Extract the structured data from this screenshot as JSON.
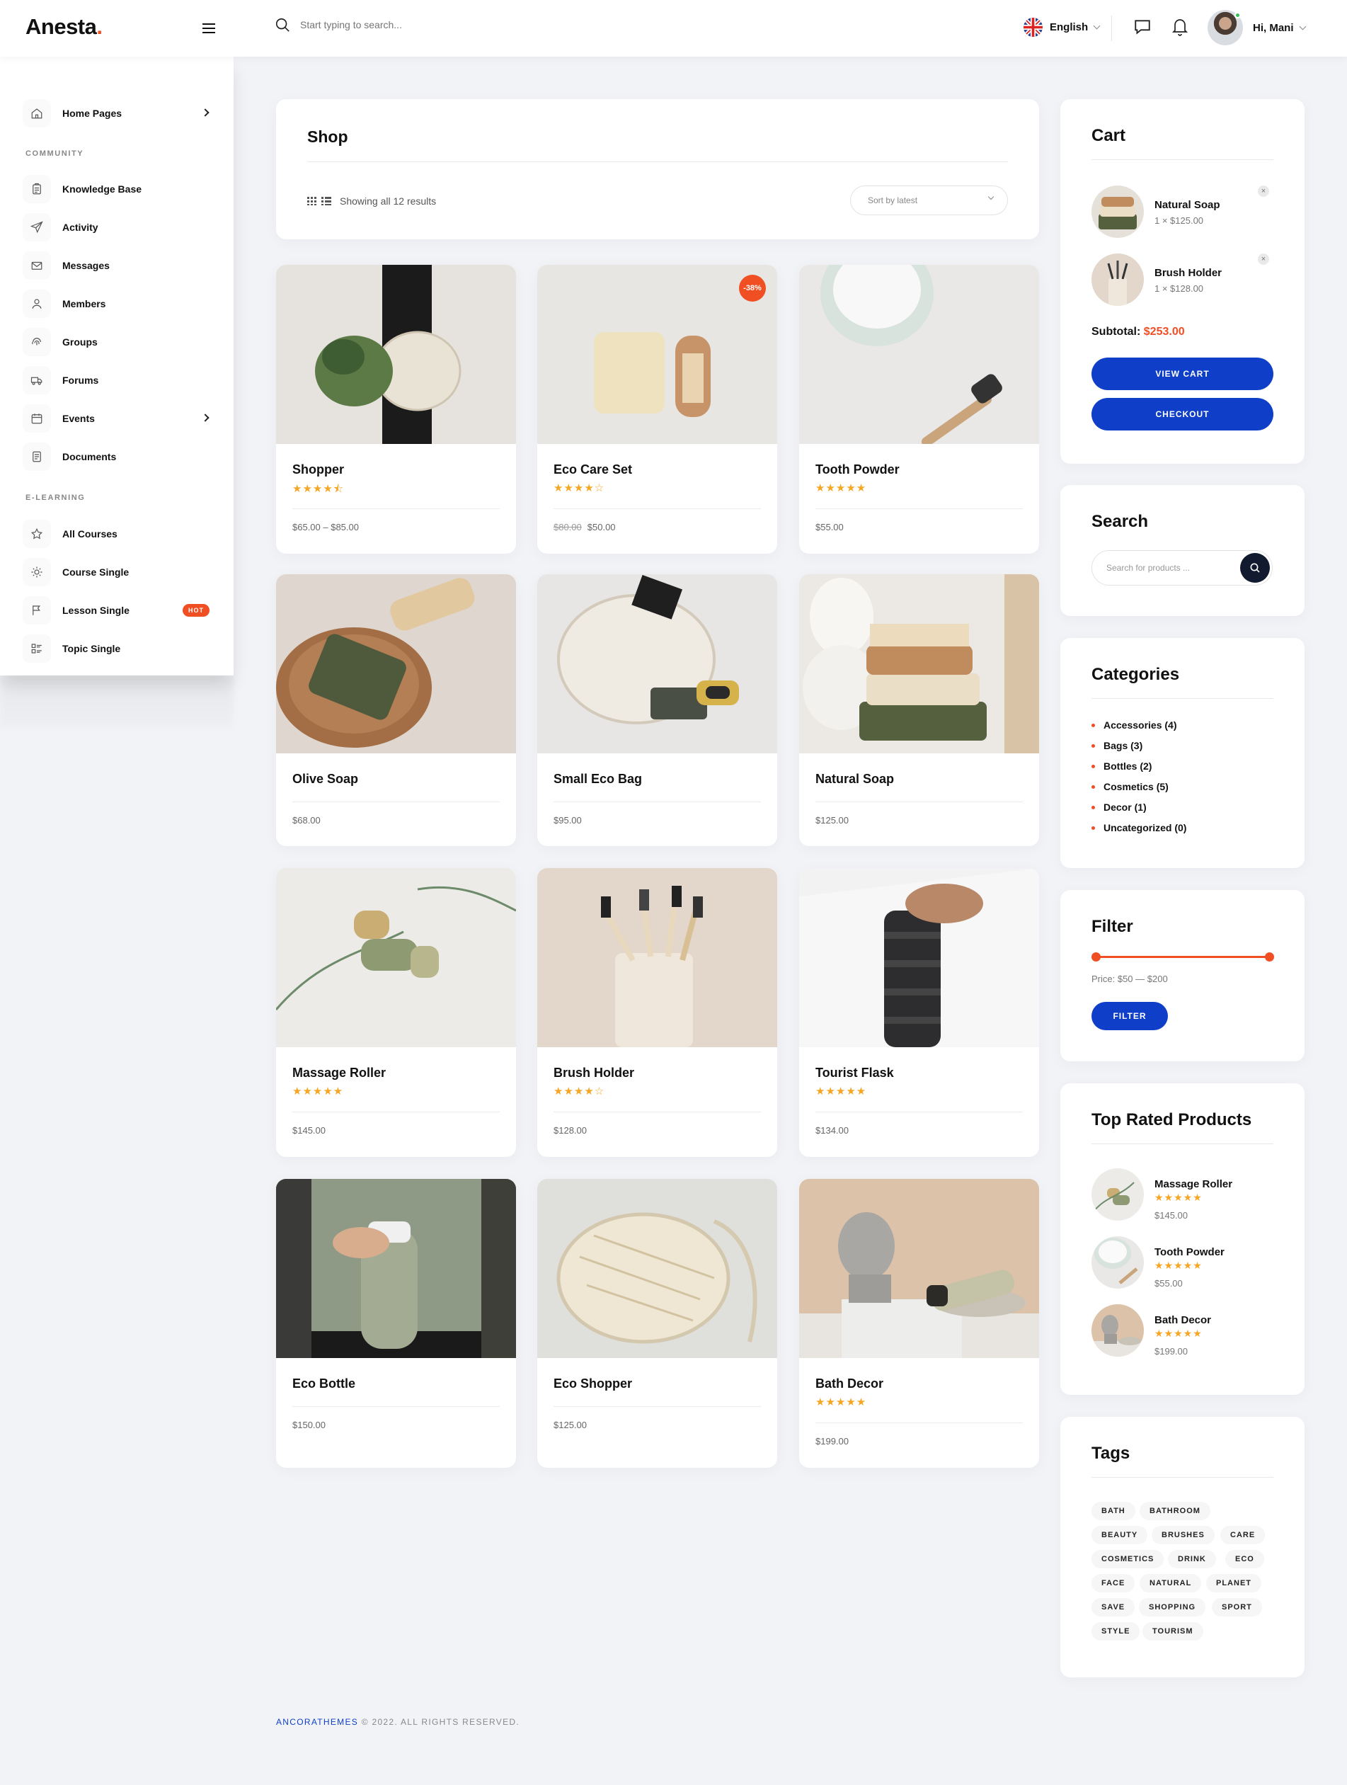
{
  "header": {
    "logo_text": "Anesta",
    "logo_dot": ".",
    "search_placeholder": "Start typing to search...",
    "language": "English",
    "greeting": "Hi,  Mani"
  },
  "sidebar": {
    "home": "Home Pages",
    "community_label": "COMMUNITY",
    "community": [
      "Knowledge Base",
      "Activity",
      "Messages",
      "Members",
      "Groups",
      "Forums",
      "Events",
      "Documents"
    ],
    "elearning_label": "E-LEARNING",
    "elearning": [
      "All Courses",
      "Course Single",
      "Lesson Single",
      "Topic Single"
    ],
    "hot_badge": "HOT"
  },
  "shop": {
    "title": "Shop",
    "showing": "Showing all 12 results",
    "sort": "Sort by latest"
  },
  "products": [
    {
      "name": "Shopper",
      "rating": 4.5,
      "stars": "★★★★⯪",
      "price": "$65.00 – $85.00"
    },
    {
      "name": "Eco Care Set",
      "rating": 4,
      "stars": "★★★★☆",
      "old_price": "$80.00",
      "price": "$50.00",
      "badge": "-38%"
    },
    {
      "name": "Tooth Powder",
      "rating": 5,
      "stars": "★★★★★",
      "price": "$55.00"
    },
    {
      "name": "Olive Soap",
      "price": "$68.00"
    },
    {
      "name": "Small Eco Bag",
      "price": "$95.00"
    },
    {
      "name": "Natural Soap",
      "price": "$125.00"
    },
    {
      "name": "Massage Roller",
      "rating": 5,
      "stars": "★★★★★",
      "price": "$145.00"
    },
    {
      "name": "Brush Holder",
      "rating": 4,
      "stars": "★★★★☆",
      "price": "$128.00"
    },
    {
      "name": "Tourist Flask",
      "rating": 5,
      "stars": "★★★★★",
      "price": "$134.00"
    },
    {
      "name": "Eco Bottle",
      "price": "$150.00"
    },
    {
      "name": "Eco Shopper",
      "price": "$125.00"
    },
    {
      "name": "Bath Decor",
      "rating": 5,
      "stars": "★★★★★",
      "price": "$199.00"
    }
  ],
  "cart": {
    "title": "Cart",
    "items": [
      {
        "name": "Natural Soap",
        "qty": "1 × $125.00",
        "remove": "×"
      },
      {
        "name": "Brush Holder",
        "qty": "1 × $128.00",
        "remove": "×"
      }
    ],
    "subtotal_label": "Subtotal:",
    "subtotal": "$253.00",
    "view_cart": "VIEW CART",
    "checkout": "CHECKOUT"
  },
  "search_widget": {
    "title": "Search",
    "placeholder": "Search for products ..."
  },
  "categories": {
    "title": "Categories",
    "items": [
      "Accessories (4)",
      "Bags (3)",
      "Bottles (2)",
      "Cosmetics (5)",
      "Decor (1)",
      "Uncategorized (0)"
    ]
  },
  "filter": {
    "title": "Filter",
    "price_range": "Price: $50 — $200",
    "button": "FILTER",
    "range_min": 50,
    "range_max": 200
  },
  "top_rated": {
    "title": "Top Rated Products",
    "items": [
      {
        "name": "Massage Roller",
        "stars": "★★★★★",
        "price": "$145.00"
      },
      {
        "name": "Tooth Powder",
        "stars": "★★★★★",
        "price": "$55.00"
      },
      {
        "name": "Bath Decor",
        "stars": "★★★★★",
        "price": "$199.00"
      }
    ]
  },
  "tags": {
    "title": "Tags",
    "items": [
      "BATH",
      "BATHROOM",
      "BEAUTY",
      "BRUSHES",
      "CARE",
      "COSMETICS",
      "DRINK",
      "ECO",
      "FACE",
      "NATURAL",
      "PLANET",
      "SAVE",
      "SHOPPING",
      "SPORT",
      "STYLE",
      "TOURISM"
    ]
  },
  "footer": {
    "brand": "ANCORATHEMES",
    "rest": " © 2022. ALL RIGHTS RESERVED."
  },
  "colors": {
    "accent": "#f04e23",
    "primary": "#0f3fc9",
    "star": "#f5a623",
    "background": "#f2f3f7"
  }
}
